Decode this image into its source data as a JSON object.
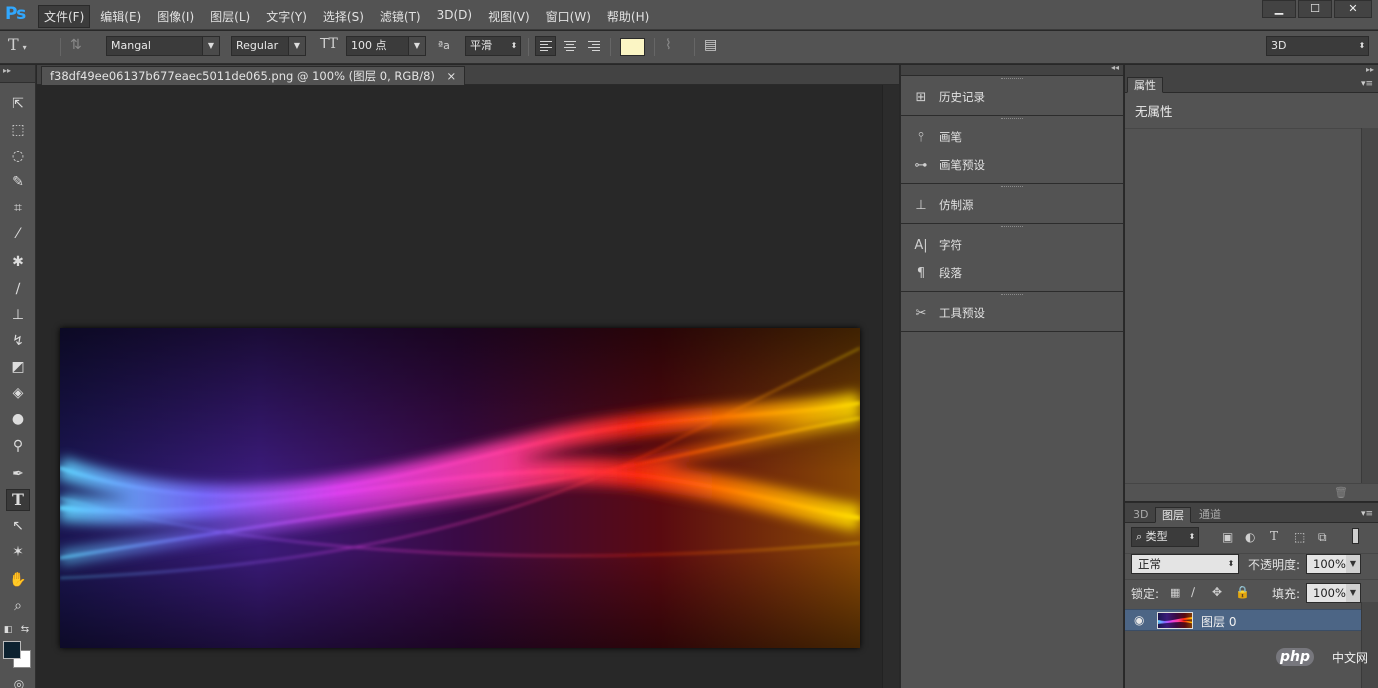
{
  "app": {
    "logo": "Ps"
  },
  "menu": [
    "文件(F)",
    "编辑(E)",
    "图像(I)",
    "图层(L)",
    "文字(Y)",
    "选择(S)",
    "滤镜(T)",
    "3D(D)",
    "视图(V)",
    "窗口(W)",
    "帮助(H)"
  ],
  "window_controls": {
    "minimize": "▁",
    "maximize": "☐",
    "close": "✕"
  },
  "options": {
    "tool_glyph": "T",
    "font_family": "Mangal",
    "font_style": "Regular",
    "font_size": "100 点",
    "aa_icon": "ªa",
    "antialias": "平滑",
    "text_color": "#fbf5c4",
    "workspace": "3D"
  },
  "document": {
    "tab_title": "f38df49ee06137b677eaec5011de065.png @ 100% (图层 0, RGB/8)",
    "tab_close": "×"
  },
  "tools": [
    "move-tool",
    "marquee-tool",
    "lasso-tool",
    "quick-select-tool",
    "crop-tool",
    "eyedropper-tool",
    "healing-brush-tool",
    "brush-tool",
    "clone-stamp-tool",
    "history-brush-tool",
    "eraser-tool",
    "paint-bucket-tool",
    "blur-tool",
    "dodge-tool",
    "pen-tool",
    "type-tool",
    "path-select-tool",
    "shape-tool",
    "hand-tool",
    "zoom-tool"
  ],
  "colors": {
    "foreground": "#0d2230",
    "background": "#ffffff"
  },
  "dock": {
    "groups": [
      [
        {
          "icon": "history-icon",
          "label": "历史记录"
        }
      ],
      [
        {
          "icon": "brush-icon",
          "label": "画笔"
        },
        {
          "icon": "brush-presets-icon",
          "label": "画笔预设"
        }
      ],
      [
        {
          "icon": "clone-source-icon",
          "label": "仿制源"
        }
      ],
      [
        {
          "icon": "character-icon",
          "label": "字符"
        },
        {
          "icon": "paragraph-icon",
          "label": "段落"
        }
      ],
      [
        {
          "icon": "tool-presets-icon",
          "label": "工具预设"
        }
      ]
    ]
  },
  "properties": {
    "tab": "属性",
    "empty_text": "无属性"
  },
  "layers": {
    "tabs": [
      "3D",
      "图层",
      "通道"
    ],
    "active_tab": "图层",
    "filter": "类型",
    "blend_mode": "正常",
    "opacity_label": "不透明度:",
    "opacity": "100%",
    "lock_label": "锁定:",
    "fill_label": "填充:",
    "fill": "100%",
    "items": [
      {
        "name": "图层 0",
        "visible": true,
        "selected": true
      }
    ]
  },
  "watermark": {
    "logo": "php",
    "text": "中文网"
  }
}
